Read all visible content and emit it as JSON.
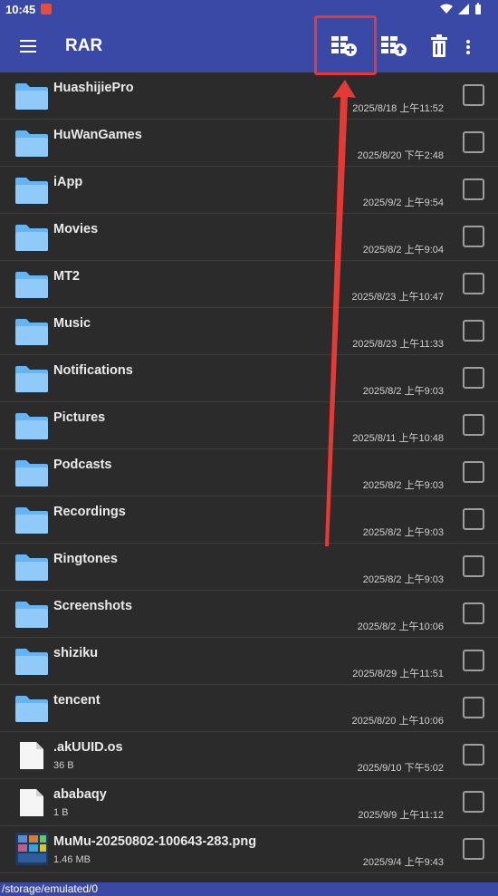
{
  "status": {
    "time": "10:45"
  },
  "appbar": {
    "title": "RAR",
    "icons": [
      "menu-icon",
      "add-to-archive-icon",
      "extract-icon",
      "trash-icon",
      "more-vert-icon"
    ]
  },
  "files": [
    {
      "name": "HuashijiePro",
      "date": "2025/8/18 上午11:52",
      "type": "folder",
      "size": ""
    },
    {
      "name": "HuWanGames",
      "date": "2025/8/20 下午2:48",
      "type": "folder",
      "size": ""
    },
    {
      "name": "iApp",
      "date": "2025/9/2 上午9:54",
      "type": "folder",
      "size": ""
    },
    {
      "name": "Movies",
      "date": "2025/8/2 上午9:04",
      "type": "folder",
      "size": ""
    },
    {
      "name": "MT2",
      "date": "2025/8/23 上午10:47",
      "type": "folder",
      "size": ""
    },
    {
      "name": "Music",
      "date": "2025/8/23 上午11:33",
      "type": "folder",
      "size": ""
    },
    {
      "name": "Notifications",
      "date": "2025/8/2 上午9:03",
      "type": "folder",
      "size": ""
    },
    {
      "name": "Pictures",
      "date": "2025/8/11 上午10:48",
      "type": "folder",
      "size": ""
    },
    {
      "name": "Podcasts",
      "date": "2025/8/2 上午9:03",
      "type": "folder",
      "size": ""
    },
    {
      "name": "Recordings",
      "date": "2025/8/2 上午9:03",
      "type": "folder",
      "size": ""
    },
    {
      "name": "Ringtones",
      "date": "2025/8/2 上午9:03",
      "type": "folder",
      "size": ""
    },
    {
      "name": "Screenshots",
      "date": "2025/8/2 上午10:06",
      "type": "folder",
      "size": ""
    },
    {
      "name": "shiziku",
      "date": "2025/8/29 上午11:51",
      "type": "folder",
      "size": ""
    },
    {
      "name": "tencent",
      "date": "2025/8/20 上午10:06",
      "type": "folder",
      "size": ""
    },
    {
      "name": ".akUUID.os",
      "date": "2025/9/10 下午5:02",
      "type": "file",
      "size": "36 B"
    },
    {
      "name": "ababaqy",
      "date": "2025/9/9 上午11:12",
      "type": "file",
      "size": "1 B"
    },
    {
      "name": "MuMu-20250802-100643-283.png",
      "date": "2025/9/4 上午9:43",
      "type": "image",
      "size": "1.46 MB"
    }
  ],
  "path": "/storage/emulated/0",
  "colors": {
    "appbar": "#3a49a6",
    "background": "#2b2b2b",
    "folder": "#64b5f6",
    "annotation": "#e53935"
  }
}
